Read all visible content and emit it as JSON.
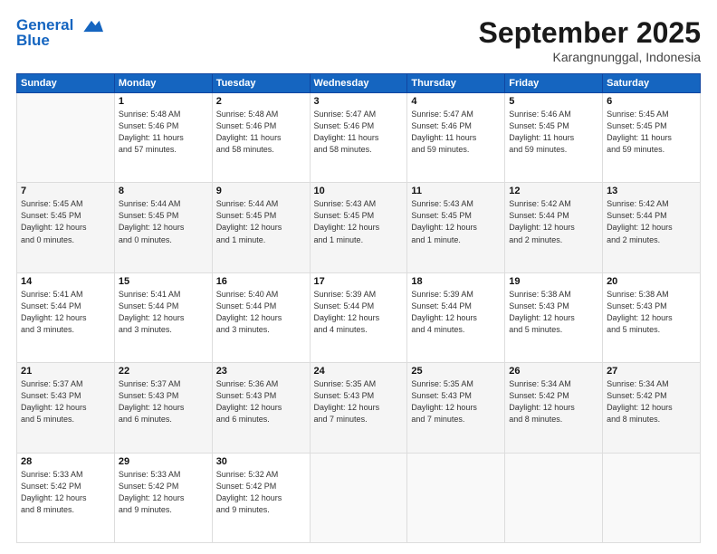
{
  "header": {
    "logo_line1": "General",
    "logo_line2": "Blue",
    "month_title": "September 2025",
    "subtitle": "Karangnunggal, Indonesia"
  },
  "weekdays": [
    "Sunday",
    "Monday",
    "Tuesday",
    "Wednesday",
    "Thursday",
    "Friday",
    "Saturday"
  ],
  "weeks": [
    [
      {
        "day": "",
        "info": ""
      },
      {
        "day": "1",
        "info": "Sunrise: 5:48 AM\nSunset: 5:46 PM\nDaylight: 11 hours\nand 57 minutes."
      },
      {
        "day": "2",
        "info": "Sunrise: 5:48 AM\nSunset: 5:46 PM\nDaylight: 11 hours\nand 58 minutes."
      },
      {
        "day": "3",
        "info": "Sunrise: 5:47 AM\nSunset: 5:46 PM\nDaylight: 11 hours\nand 58 minutes."
      },
      {
        "day": "4",
        "info": "Sunrise: 5:47 AM\nSunset: 5:46 PM\nDaylight: 11 hours\nand 59 minutes."
      },
      {
        "day": "5",
        "info": "Sunrise: 5:46 AM\nSunset: 5:45 PM\nDaylight: 11 hours\nand 59 minutes."
      },
      {
        "day": "6",
        "info": "Sunrise: 5:45 AM\nSunset: 5:45 PM\nDaylight: 11 hours\nand 59 minutes."
      }
    ],
    [
      {
        "day": "7",
        "info": "Sunrise: 5:45 AM\nSunset: 5:45 PM\nDaylight: 12 hours\nand 0 minutes."
      },
      {
        "day": "8",
        "info": "Sunrise: 5:44 AM\nSunset: 5:45 PM\nDaylight: 12 hours\nand 0 minutes."
      },
      {
        "day": "9",
        "info": "Sunrise: 5:44 AM\nSunset: 5:45 PM\nDaylight: 12 hours\nand 1 minute."
      },
      {
        "day": "10",
        "info": "Sunrise: 5:43 AM\nSunset: 5:45 PM\nDaylight: 12 hours\nand 1 minute."
      },
      {
        "day": "11",
        "info": "Sunrise: 5:43 AM\nSunset: 5:45 PM\nDaylight: 12 hours\nand 1 minute."
      },
      {
        "day": "12",
        "info": "Sunrise: 5:42 AM\nSunset: 5:44 PM\nDaylight: 12 hours\nand 2 minutes."
      },
      {
        "day": "13",
        "info": "Sunrise: 5:42 AM\nSunset: 5:44 PM\nDaylight: 12 hours\nand 2 minutes."
      }
    ],
    [
      {
        "day": "14",
        "info": "Sunrise: 5:41 AM\nSunset: 5:44 PM\nDaylight: 12 hours\nand 3 minutes."
      },
      {
        "day": "15",
        "info": "Sunrise: 5:41 AM\nSunset: 5:44 PM\nDaylight: 12 hours\nand 3 minutes."
      },
      {
        "day": "16",
        "info": "Sunrise: 5:40 AM\nSunset: 5:44 PM\nDaylight: 12 hours\nand 3 minutes."
      },
      {
        "day": "17",
        "info": "Sunrise: 5:39 AM\nSunset: 5:44 PM\nDaylight: 12 hours\nand 4 minutes."
      },
      {
        "day": "18",
        "info": "Sunrise: 5:39 AM\nSunset: 5:44 PM\nDaylight: 12 hours\nand 4 minutes."
      },
      {
        "day": "19",
        "info": "Sunrise: 5:38 AM\nSunset: 5:43 PM\nDaylight: 12 hours\nand 5 minutes."
      },
      {
        "day": "20",
        "info": "Sunrise: 5:38 AM\nSunset: 5:43 PM\nDaylight: 12 hours\nand 5 minutes."
      }
    ],
    [
      {
        "day": "21",
        "info": "Sunrise: 5:37 AM\nSunset: 5:43 PM\nDaylight: 12 hours\nand 5 minutes."
      },
      {
        "day": "22",
        "info": "Sunrise: 5:37 AM\nSunset: 5:43 PM\nDaylight: 12 hours\nand 6 minutes."
      },
      {
        "day": "23",
        "info": "Sunrise: 5:36 AM\nSunset: 5:43 PM\nDaylight: 12 hours\nand 6 minutes."
      },
      {
        "day": "24",
        "info": "Sunrise: 5:35 AM\nSunset: 5:43 PM\nDaylight: 12 hours\nand 7 minutes."
      },
      {
        "day": "25",
        "info": "Sunrise: 5:35 AM\nSunset: 5:43 PM\nDaylight: 12 hours\nand 7 minutes."
      },
      {
        "day": "26",
        "info": "Sunrise: 5:34 AM\nSunset: 5:42 PM\nDaylight: 12 hours\nand 8 minutes."
      },
      {
        "day": "27",
        "info": "Sunrise: 5:34 AM\nSunset: 5:42 PM\nDaylight: 12 hours\nand 8 minutes."
      }
    ],
    [
      {
        "day": "28",
        "info": "Sunrise: 5:33 AM\nSunset: 5:42 PM\nDaylight: 12 hours\nand 8 minutes."
      },
      {
        "day": "29",
        "info": "Sunrise: 5:33 AM\nSunset: 5:42 PM\nDaylight: 12 hours\nand 9 minutes."
      },
      {
        "day": "30",
        "info": "Sunrise: 5:32 AM\nSunset: 5:42 PM\nDaylight: 12 hours\nand 9 minutes."
      },
      {
        "day": "",
        "info": ""
      },
      {
        "day": "",
        "info": ""
      },
      {
        "day": "",
        "info": ""
      },
      {
        "day": "",
        "info": ""
      }
    ]
  ]
}
